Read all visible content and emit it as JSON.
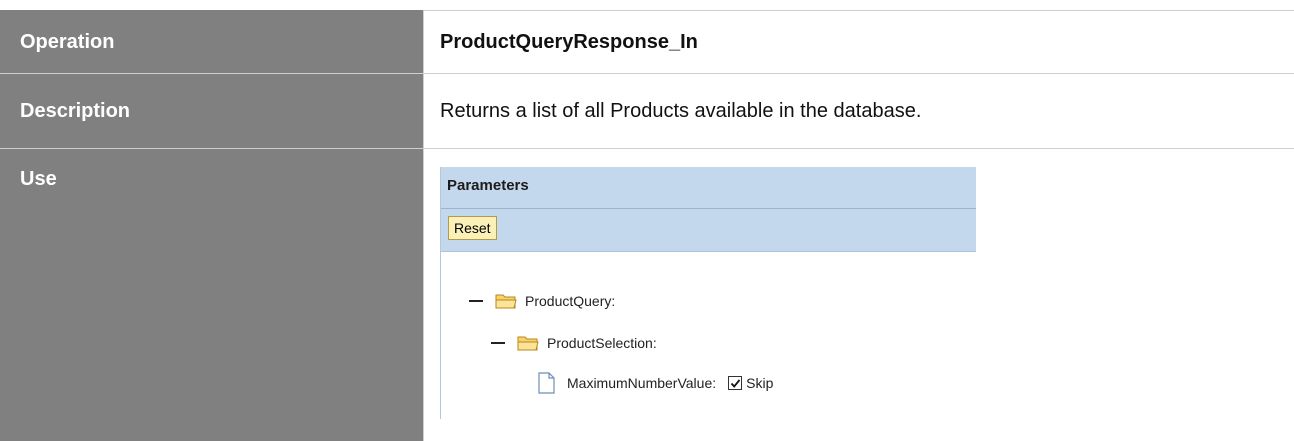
{
  "rows": [
    {
      "label": "Operation",
      "value": "ProductQueryResponse_In"
    },
    {
      "label": "Description",
      "value": "Returns a list of all Products available in the database."
    },
    {
      "label": "Use"
    }
  ],
  "parameters_panel": {
    "title": "Parameters",
    "reset_label": "Reset",
    "tree": [
      {
        "name": "ProductQuery:",
        "icon": "folder-icon",
        "expanded": true
      },
      {
        "name": "ProductSelection:",
        "icon": "folder-icon",
        "expanded": true
      },
      {
        "name": "MaximumNumberValue:",
        "icon": "document-icon",
        "checkbox_label": "Skip",
        "checked": true
      }
    ]
  },
  "colors": {
    "label_bg": "#808080",
    "panel_header_bg": "#c4d8ed",
    "reset_bg": "#fbf1b8"
  }
}
